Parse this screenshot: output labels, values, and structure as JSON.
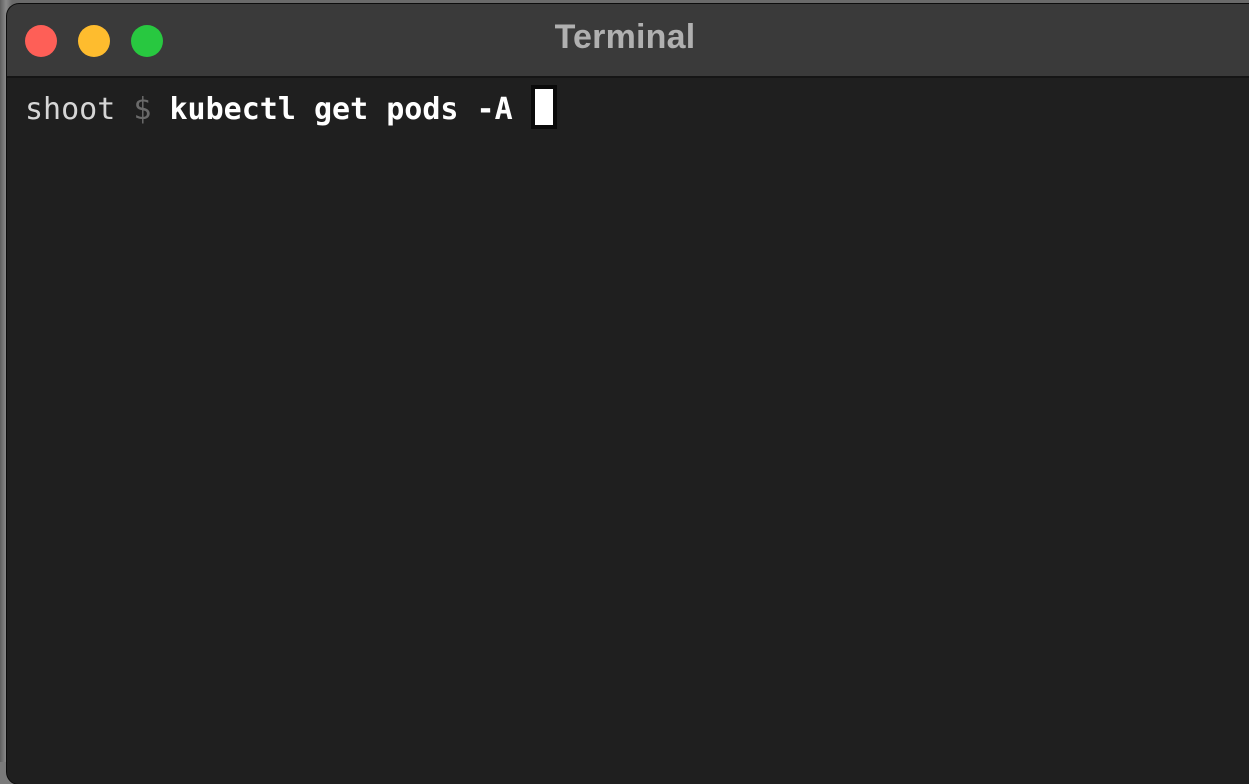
{
  "window": {
    "title": "Terminal",
    "colors": {
      "close": "#fe5f57",
      "minimize": "#febc2e",
      "maximize": "#28c840",
      "background": "#1f1f1f"
    }
  },
  "terminal": {
    "user": "shoot",
    "prompt_symbol": "$",
    "command": "kubectl get pods -A"
  }
}
